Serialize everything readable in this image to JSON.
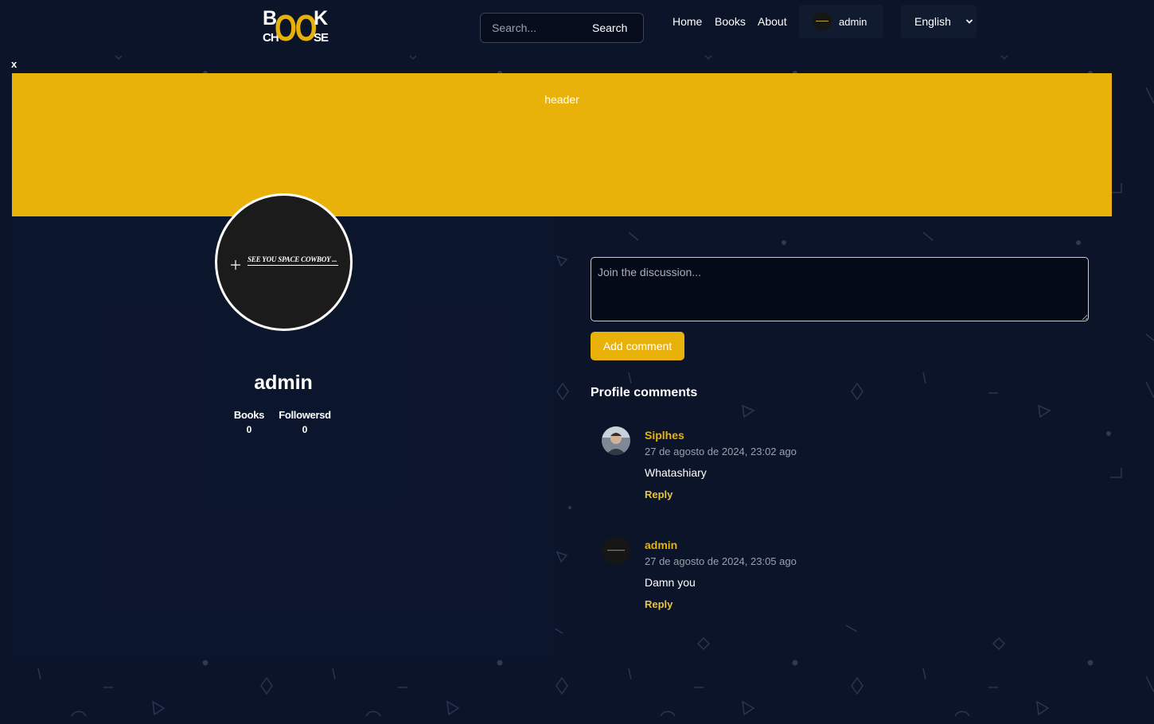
{
  "logo": {
    "line1_left": "B",
    "middle": "OO",
    "line1_right": "K",
    "line2_left": "CH",
    "line2_right": "SE"
  },
  "nav": {
    "search_placeholder": "Search...",
    "search_button": "Search",
    "links": {
      "home": "Home",
      "books": "Books",
      "about": "About"
    },
    "user_name": "admin",
    "language": "English"
  },
  "banner": {
    "close_label": "x",
    "label": "header"
  },
  "profile": {
    "avatar_text": "SEE YOU SPACE COWBOY ...",
    "name": "admin",
    "stats": {
      "books": {
        "label": "Books",
        "value": "0"
      },
      "followers": {
        "label": "Followersd",
        "value": "0"
      }
    }
  },
  "comments": {
    "placeholder": "Join the discussion...",
    "add_button": "Add comment",
    "section_title": "Profile comments",
    "items": [
      {
        "author": "Siplhes",
        "date": "27 de agosto de 2024, 23:02 ago",
        "body": "Whatashiary",
        "reply": "Reply"
      },
      {
        "author": "admin",
        "date": "27 de agosto de 2024, 23:05 ago",
        "body": "Damn you",
        "reply": "Reply"
      }
    ]
  },
  "colors": {
    "accent": "#e8b20b",
    "background": "#0b1429",
    "panel": "#111b30"
  },
  "icons": {
    "chevron": "chevron-down-icon",
    "cross": "crosshair-icon"
  }
}
